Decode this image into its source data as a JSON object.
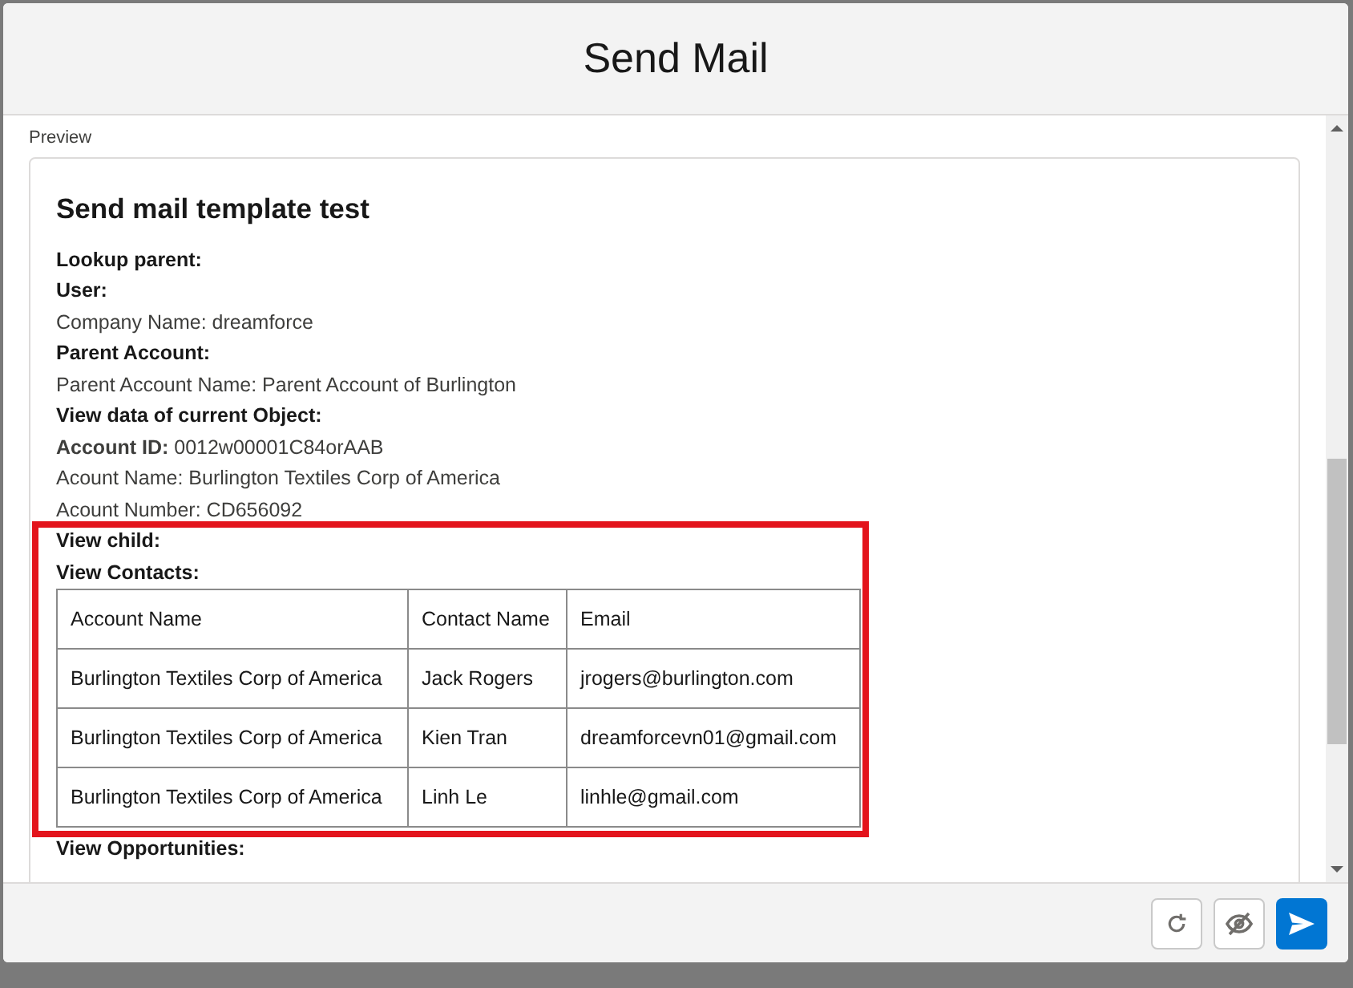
{
  "modal": {
    "title": "Send Mail"
  },
  "preview": {
    "label": "Preview",
    "heading": "Send mail template test",
    "lines": [
      {
        "kind": "bold",
        "text": "Lookup parent:"
      },
      {
        "kind": "bold",
        "text": "User:"
      },
      {
        "kind": "plain",
        "text": "Company Name: dreamforce"
      },
      {
        "kind": "bold",
        "text": "Parent Account:"
      },
      {
        "kind": "plain",
        "text": "Parent Account Name: Parent Account of Burlington"
      },
      {
        "kind": "bold",
        "text": "View data of current Object:"
      },
      {
        "kind": "plain",
        "text": "**Account ID:** 0012w00001C84orAAB"
      },
      {
        "kind": "plain",
        "text": "Acount Name: Burlington Textiles Corp of America"
      },
      {
        "kind": "plain",
        "text": "Acount Number: CD656092"
      }
    ],
    "highlighted": {
      "lines": [
        {
          "kind": "bold",
          "text": "View child:"
        },
        {
          "kind": "bold",
          "text": "View Contacts:"
        }
      ],
      "table": {
        "columns": [
          "Account Name",
          "Contact Name",
          "Email"
        ],
        "rows": [
          [
            "Burlington Textiles Corp of America",
            "Jack Rogers",
            "jrogers@burlington.com"
          ],
          [
            "Burlington Textiles Corp of America",
            "Kien Tran",
            "dreamforcevn01@gmail.com"
          ],
          [
            "Burlington Textiles Corp of America",
            "Linh Le",
            "linhle@gmail.com"
          ]
        ]
      }
    },
    "after_lines": [
      {
        "kind": "bold",
        "text": "View Opportunities:"
      }
    ]
  }
}
